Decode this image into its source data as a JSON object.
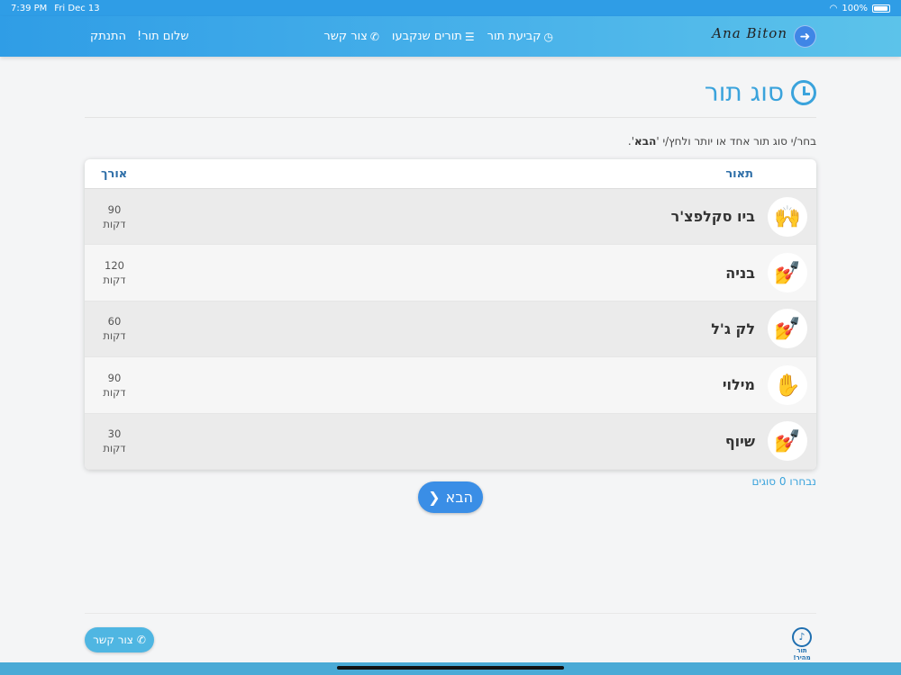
{
  "status_bar": {
    "time": "7:39 PM",
    "date": "Fri Dec 13",
    "battery": "100%"
  },
  "navbar": {
    "brand": "Ana Biton",
    "links": [
      {
        "label": "קביעת תור",
        "icon": "clock-icon"
      },
      {
        "label": "תורים שנקבעו",
        "icon": "list-icon"
      },
      {
        "label": "צור קשר",
        "icon": "phone-icon"
      }
    ],
    "greeting": "שלום תור!",
    "logout": "התנתק"
  },
  "page": {
    "title": "סוג תור",
    "instructions_prefix": "בחר/י סוג תור אחד או יותר ולחץ/י '",
    "instructions_bold": "הבא",
    "instructions_suffix": "'."
  },
  "table": {
    "headers": {
      "description": "תאור",
      "length": "אורך"
    },
    "rows": [
      {
        "name": "ביו סקלפצ'ר",
        "minutes": "90",
        "unit": "דקות",
        "icon": "hands-icon"
      },
      {
        "name": "בניה",
        "minutes": "120",
        "unit": "דקות",
        "icon": "nails-icon"
      },
      {
        "name": "לק ג'ל",
        "minutes": "60",
        "unit": "דקות",
        "icon": "gel-polish-icon"
      },
      {
        "name": "מילוי",
        "minutes": "90",
        "unit": "דקות",
        "icon": "nail-fill-icon"
      },
      {
        "name": "שיוף",
        "minutes": "30",
        "unit": "דקות",
        "icon": "nail-file-icon"
      }
    ]
  },
  "selected_count": "נבחרו 0 סוגים",
  "next_button": "הבא",
  "footer": {
    "contact_button": "צור קשר",
    "logo_text": "תור מהיר!"
  },
  "colors": {
    "primary": "#3a8ee6",
    "accent": "#3aa3dc",
    "header_text": "#2f6fa8"
  }
}
